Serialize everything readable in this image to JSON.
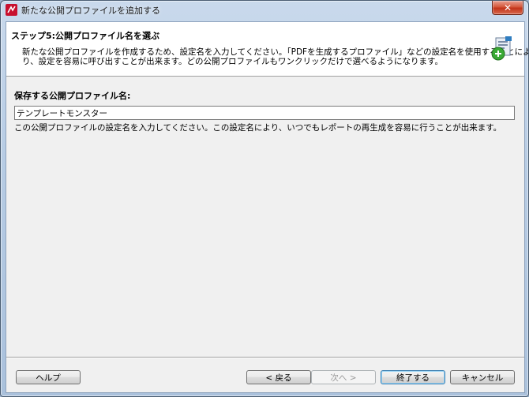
{
  "window": {
    "title": "新たな公開プロファイルを追加する",
    "close_glyph": "✕"
  },
  "header": {
    "step_title": "ステップ5:公開プロファイル名を選ぶ",
    "description_line1": "新たな公開プロファイルを作成するため、設定名を入力してください。「PDFを生成するプロファイル」などの設定名を使用することによ",
    "description_line2": "り、設定を容易に呼び出すことが出来ます。どの公開プロファイルもワンクリックだけで選べるようになります。",
    "icon": "wizard-add-icon"
  },
  "form": {
    "label": "保存する公開プロファイル名:",
    "profile_name_value": "テンプレートモンスター",
    "hint": "この公開プロファイルの設定名を入力してください。この設定名により、いつでもレポートの再生成を容易に行うことが出来ます。"
  },
  "buttons": {
    "help": "ヘルプ",
    "back": "< 戻る",
    "next": "次へ >",
    "finish": "終了する",
    "cancel": "キャンセル"
  },
  "colors": {
    "accent_red": "#c8102e",
    "close_red": "#c2341a",
    "add_green": "#3aa935"
  }
}
